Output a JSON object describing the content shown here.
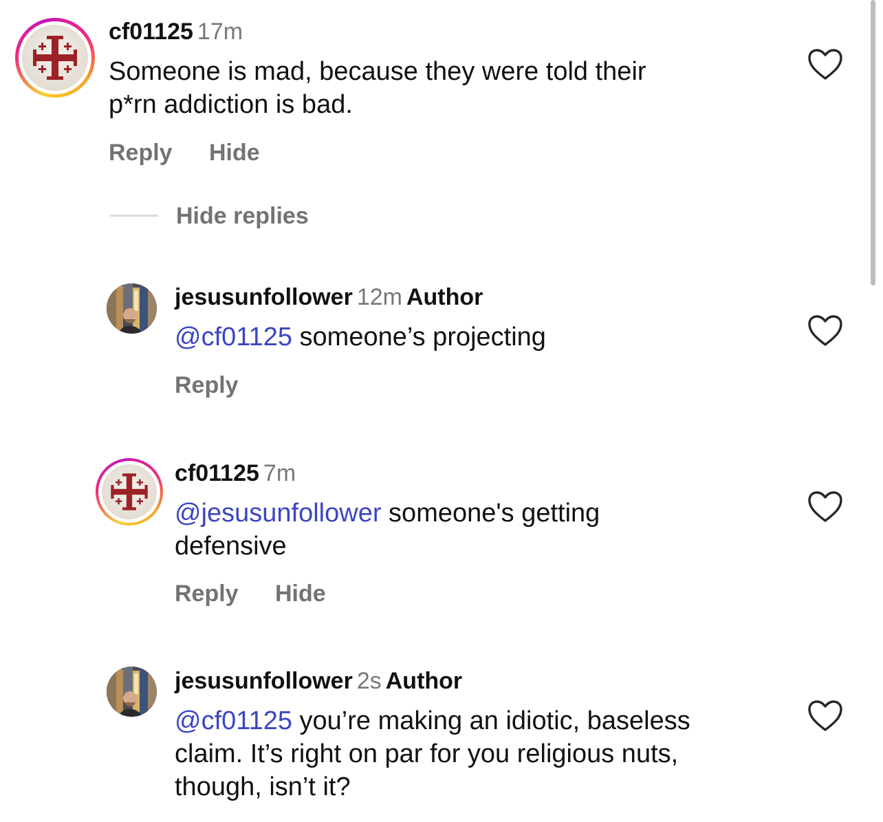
{
  "comments": [
    {
      "username": "cf01125",
      "time": "17m",
      "text_line1": "Someone is mad, because they were told their",
      "text_line2": "p*rn addiction is bad.",
      "reply_label": "Reply",
      "hide_label": "Hide",
      "avatar": "jerusalem-cross-avatar"
    },
    {
      "username": "jesusunfollower",
      "time": "12m",
      "badge": "Author",
      "mention": "@cf01125",
      "text": " someone’s projecting",
      "reply_label": "Reply",
      "avatar": "photo-avatar"
    },
    {
      "username": "cf01125",
      "time": "7m",
      "mention": "@jesusunfollower",
      "text_line1": " someone's getting",
      "text_line2": "defensive",
      "reply_label": "Reply",
      "hide_label": "Hide",
      "avatar": "jerusalem-cross-avatar"
    },
    {
      "username": "jesusunfollower",
      "time": "2s",
      "badge": "Author",
      "mention": "@cf01125",
      "text_line1": " you’re making an idiotic, baseless",
      "text_line2": "claim. It’s right on par for you religious nuts,",
      "text_line3": "though, isn’t it?",
      "avatar": "photo-avatar"
    }
  ],
  "thread": {
    "hide_replies_label": "Hide replies"
  },
  "colors": {
    "mention": "#3b45c4",
    "secondary_text": "#737373",
    "cross_red": "#9b2226"
  },
  "icons": {
    "like": "heart-outline-icon"
  }
}
